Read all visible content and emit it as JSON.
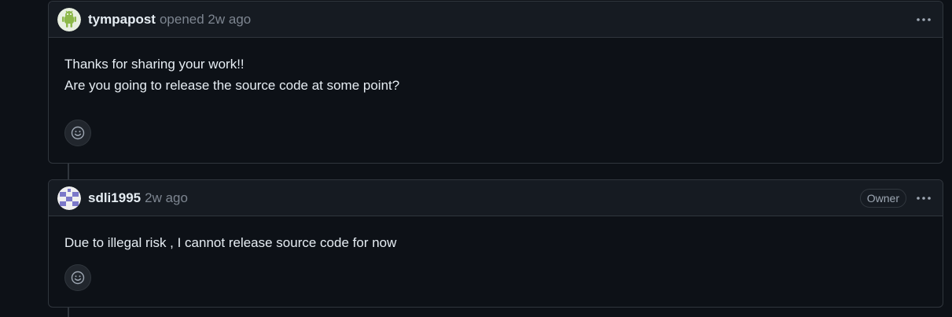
{
  "comments": [
    {
      "author": "tympapost",
      "meta": "opened 2w ago",
      "body": [
        "Thanks for sharing your work!!",
        "Are you going to release the source code at some point?"
      ],
      "avatar_icon": "android-avatar-icon"
    },
    {
      "author": "sdli1995",
      "meta": "2w ago",
      "badge": "Owner",
      "body": [
        "Due to illegal risk , I cannot release source code for now"
      ],
      "avatar_icon": "identicon-avatar-icon"
    }
  ],
  "icons": {
    "options": "kebab-horizontal-icon",
    "reaction": "smiley-icon"
  },
  "colors": {
    "background": "#0d1117",
    "header": "#161b22",
    "border": "#30363d",
    "text": "#e6edf3",
    "muted": "#7d8590",
    "avatar_green": "#8db84a",
    "avatar_purple": "#7b78c9"
  }
}
